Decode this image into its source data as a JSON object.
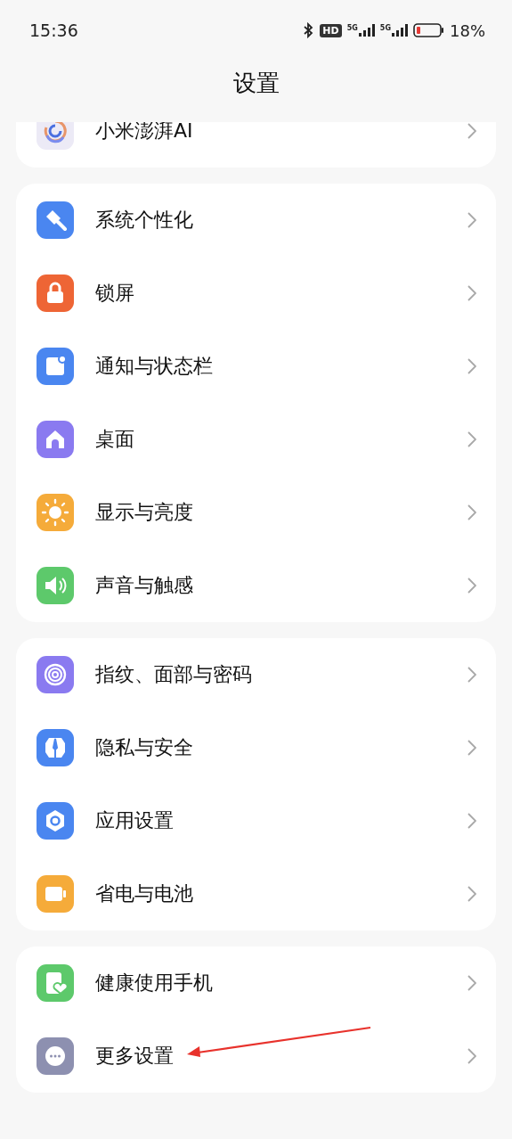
{
  "status_bar": {
    "time": "15:36",
    "hd_badge": "HD",
    "sim_1": "5G",
    "sim_2": "5G",
    "battery": "18%"
  },
  "title": "设置",
  "groups": [
    {
      "items": [
        {
          "kind": "ai",
          "label": "小米澎湃AI",
          "pointed": false
        }
      ]
    },
    {
      "items": [
        {
          "kind": "brush",
          "label": "系统个性化",
          "pointed": false
        },
        {
          "kind": "lock",
          "label": "锁屏",
          "pointed": false
        },
        {
          "kind": "notification",
          "label": "通知与状态栏",
          "pointed": false
        },
        {
          "kind": "home",
          "label": "桌面",
          "pointed": false
        },
        {
          "kind": "sun",
          "label": "显示与亮度",
          "pointed": false
        },
        {
          "kind": "sound",
          "label": "声音与触感",
          "pointed": false
        }
      ]
    },
    {
      "items": [
        {
          "kind": "fingerprint",
          "label": "指纹、面部与密码",
          "pointed": false
        },
        {
          "kind": "shield",
          "label": "隐私与安全",
          "pointed": false
        },
        {
          "kind": "apps",
          "label": "应用设置",
          "pointed": false
        },
        {
          "kind": "battery",
          "label": "省电与电池",
          "pointed": false
        }
      ]
    },
    {
      "items": [
        {
          "kind": "health",
          "label": "健康使用手机",
          "pointed": false
        },
        {
          "kind": "more",
          "label": "更多设置",
          "pointed": true
        }
      ]
    }
  ]
}
